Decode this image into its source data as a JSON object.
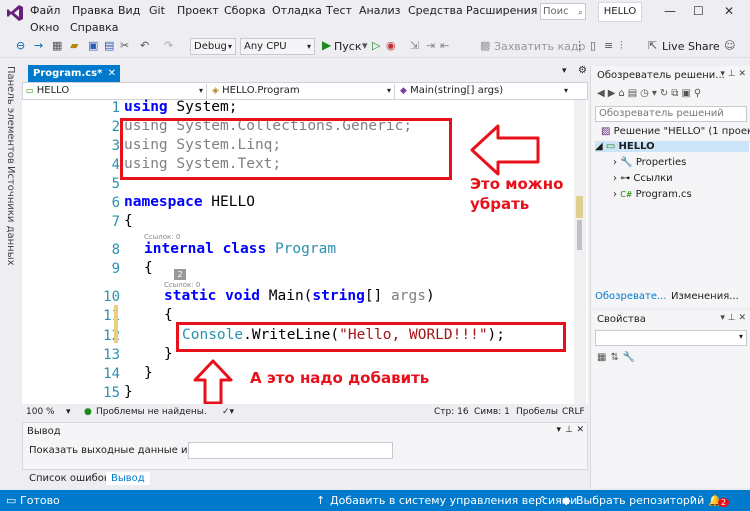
{
  "menu": {
    "items": [
      "Файл",
      "Правка",
      "Вид",
      "Git",
      "Проект",
      "Сборка",
      "Отладка",
      "Тест",
      "Анализ",
      "Средства",
      "Расширения",
      "Окно",
      "Справка"
    ],
    "search_placeholder": "Поис",
    "project_title": "HELLO"
  },
  "toolbar": {
    "config": "Debug",
    "platform": "Any CPU",
    "run_label": "Пуск",
    "capture_label": "Захватить кадр",
    "live_share": "Live Share"
  },
  "left_rail": {
    "toolbox": "Панель элементов",
    "datasources": "Источники данных"
  },
  "editor": {
    "tab_label": "Program.cs*",
    "tab_close": "✕",
    "nav": {
      "project": "HELLO",
      "class": "HELLO.Program",
      "member": "Main(string[] args)"
    },
    "line_numbers": [
      "1",
      "2",
      "3",
      "4",
      "5",
      "6",
      "7",
      "8",
      "9",
      "10",
      "11",
      "12",
      "13",
      "14",
      "15"
    ],
    "codelens": [
      "Ссылок: 0",
      "Ссылок: 0"
    ],
    "codelens_badge": "2",
    "code": {
      "l1_kw": "using",
      "l1_rest": " System;",
      "l2": "using System.Collections.Generic;",
      "l3": "using System.Linq;",
      "l4": "using System.Text;",
      "l6_kw": "namespace",
      "l6_rest": " HELLO",
      "l7": "{",
      "l8_kw": "internal class",
      "l8_type": "Program",
      "l9": "{",
      "l10_kw": "static void",
      "l10_name": " Main(",
      "l10_kw2": "string",
      "l10_rest": "[] ",
      "l10_arg": "args",
      "l10_end": ")",
      "l11": "{",
      "l12_type": "Console",
      "l12_mid": ".WriteLine(",
      "l12_str": "\"Hello, WORLD!!!\"",
      "l12_end": ");",
      "l13": "}",
      "l14": "}",
      "l15": "}"
    },
    "annotation_remove": "Это можно\nубрать",
    "annotation_add": "А это надо добавить",
    "status": {
      "zoom": "100 %",
      "issues": "Проблемы не найдены.",
      "line": "Стр: 16",
      "col": "Симв: 1",
      "spaces": "Пробелы",
      "eol": "CRLF"
    }
  },
  "output": {
    "title": "Вывод",
    "show_from_label": "Показать выходные данные из:"
  },
  "bottom_tabs": [
    "Список ошибок",
    "Вывод"
  ],
  "solution_explorer": {
    "title": "Обозреватель решени...",
    "search_placeholder": "Обозреватель решений",
    "solution": "Решение \"HELLO\" (1 проек",
    "project": "HELLO",
    "properties": "Properties",
    "references": "Ссылки",
    "file": "Program.cs",
    "tabs": [
      "Обозревате...",
      "Изменения..."
    ]
  },
  "properties": {
    "title": "Свойства"
  },
  "statusbar": {
    "ready": "Готово",
    "add_vcs": "Добавить в систему управления версиями",
    "select_repo": "Выбрать репозиторий",
    "notifications": "2"
  },
  "colors": {
    "accent": "#007acc",
    "annotation": "#e8101a",
    "keyword": "#0000ff",
    "type": "#2b91af",
    "string": "#a31515"
  }
}
